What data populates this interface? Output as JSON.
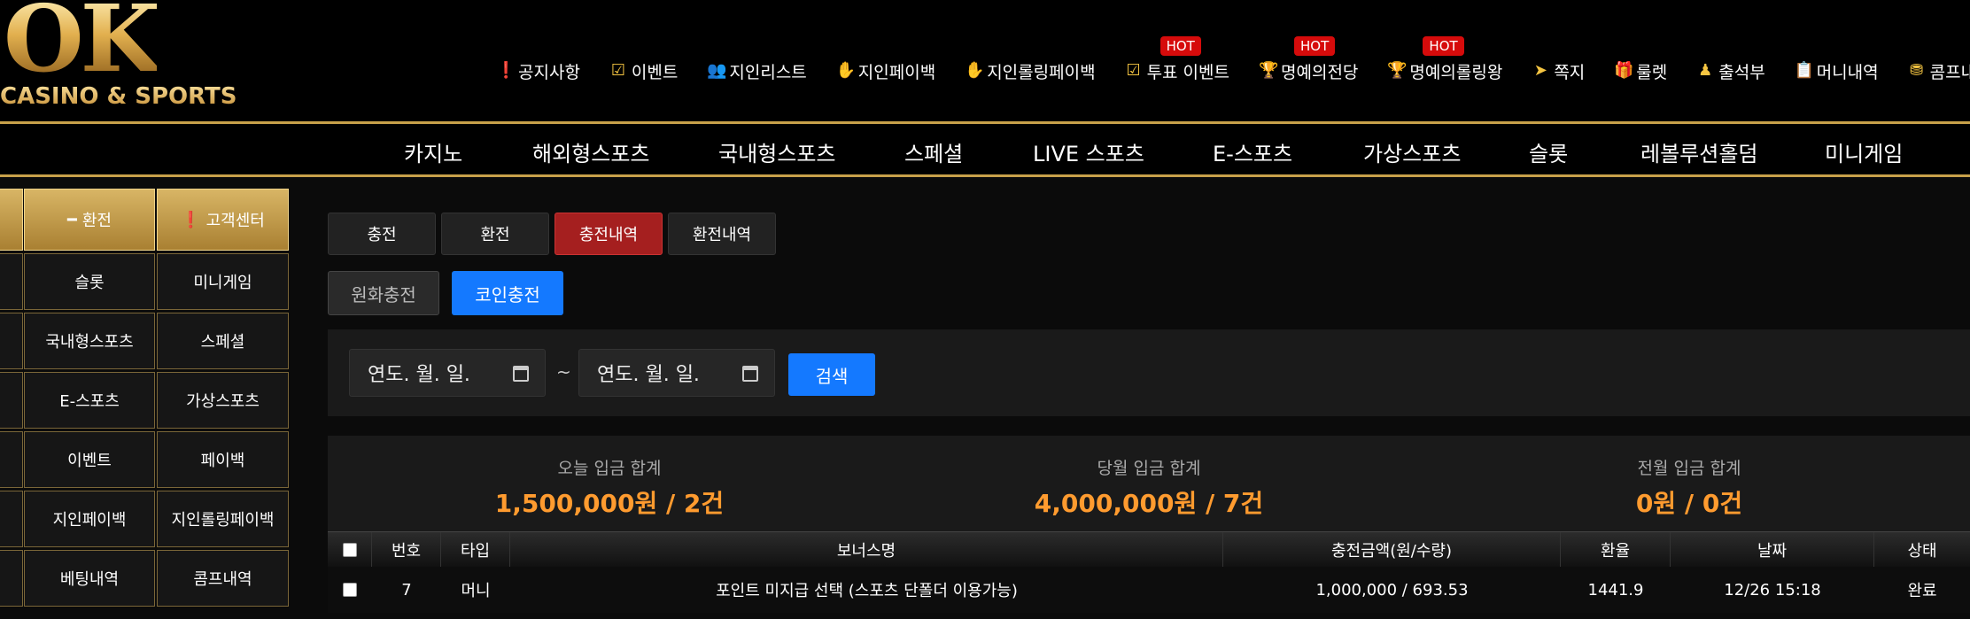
{
  "logo": {
    "main": "OK",
    "sub": "CASINO & SPORTS"
  },
  "topnav": [
    {
      "label": "공지사항",
      "icon": "info-circle-icon",
      "glyph": "❗",
      "hot": ""
    },
    {
      "label": "이벤트",
      "icon": "calendar-check-icon",
      "glyph": "☑",
      "hot": ""
    },
    {
      "label": "지인리스트",
      "icon": "users-icon",
      "glyph": "👥",
      "hot": ""
    },
    {
      "label": "지인페이백",
      "icon": "hand-coin-icon",
      "glyph": "✋",
      "hot": ""
    },
    {
      "label": "지인롤링페이백",
      "icon": "hand-coin-icon",
      "glyph": "✋",
      "hot": ""
    },
    {
      "label": "투표 이벤트",
      "icon": "vote-icon",
      "glyph": "☑",
      "hot": "HOT"
    },
    {
      "label": "명예의전당",
      "icon": "trophy-icon",
      "glyph": "🏆",
      "hot": "HOT"
    },
    {
      "label": "명예의롤링왕",
      "icon": "trophy-icon",
      "glyph": "🏆",
      "hot": "HOT"
    },
    {
      "label": "쪽지",
      "icon": "paper-plane-icon",
      "glyph": "➤",
      "hot": ""
    },
    {
      "label": "룰렛",
      "icon": "gift-icon",
      "glyph": "🎁",
      "hot": ""
    },
    {
      "label": "출석부",
      "icon": "stamp-icon",
      "glyph": "♟",
      "hot": ""
    },
    {
      "label": "머니내역",
      "icon": "clipboard-icon",
      "glyph": "📋",
      "hot": ""
    },
    {
      "label": "콤프내",
      "icon": "coins-icon",
      "glyph": "⛃",
      "hot": ""
    }
  ],
  "mainnav": [
    "카지노",
    "해외형스포츠",
    "국내형스포츠",
    "스페셜",
    "LIVE 스포츠",
    "E-스포츠",
    "가상스포츠",
    "슬롯",
    "레볼루션홀덤",
    "미니게임"
  ],
  "sidebar": {
    "top": [
      {
        "label": "환전",
        "glyph": "━"
      },
      {
        "label": "고객센터",
        "glyph": "❗"
      }
    ],
    "rows": [
      [
        "슬롯",
        "미니게임"
      ],
      [
        "국내형스포츠",
        "스페셜"
      ],
      [
        "E-스포츠",
        "가상스포츠"
      ],
      [
        "이벤트",
        "페이백"
      ],
      [
        "지인페이백",
        "지인롤링페이백"
      ],
      [
        "베팅내역",
        "콤프내역"
      ]
    ]
  },
  "tabs": [
    "충전",
    "환전",
    "충전내역",
    "환전내역"
  ],
  "subtabs": {
    "won": "원화충전",
    "coin": "코인충전"
  },
  "search": {
    "date_placeholder": "연도. 월. 일.",
    "separator": "~",
    "button": "검색"
  },
  "summary": [
    {
      "label": "오늘 입금 합계",
      "value": "1,500,000원 / 2건"
    },
    {
      "label": "당월 입금 합계",
      "value": "4,000,000원 / 7건"
    },
    {
      "label": "전월 입금 합계",
      "value": "0원 / 0건"
    }
  ],
  "table": {
    "headers": [
      "번호",
      "타입",
      "보너스명",
      "충전금액(원/수량)",
      "환율",
      "날짜",
      "상태"
    ],
    "rows": [
      [
        "7",
        "머니",
        "포인트 미지급 선택 (스포츠 단폴더 이용가능)",
        "1,000,000 / 693.53",
        "1441.9",
        "12/26 15:18",
        "완료"
      ]
    ]
  },
  "colors": {
    "gold": "#c8a14a",
    "active_red": "#a51f1f",
    "blue": "#1479ff",
    "orange": "#ff9b2f",
    "hot_red": "#d60b0b"
  }
}
